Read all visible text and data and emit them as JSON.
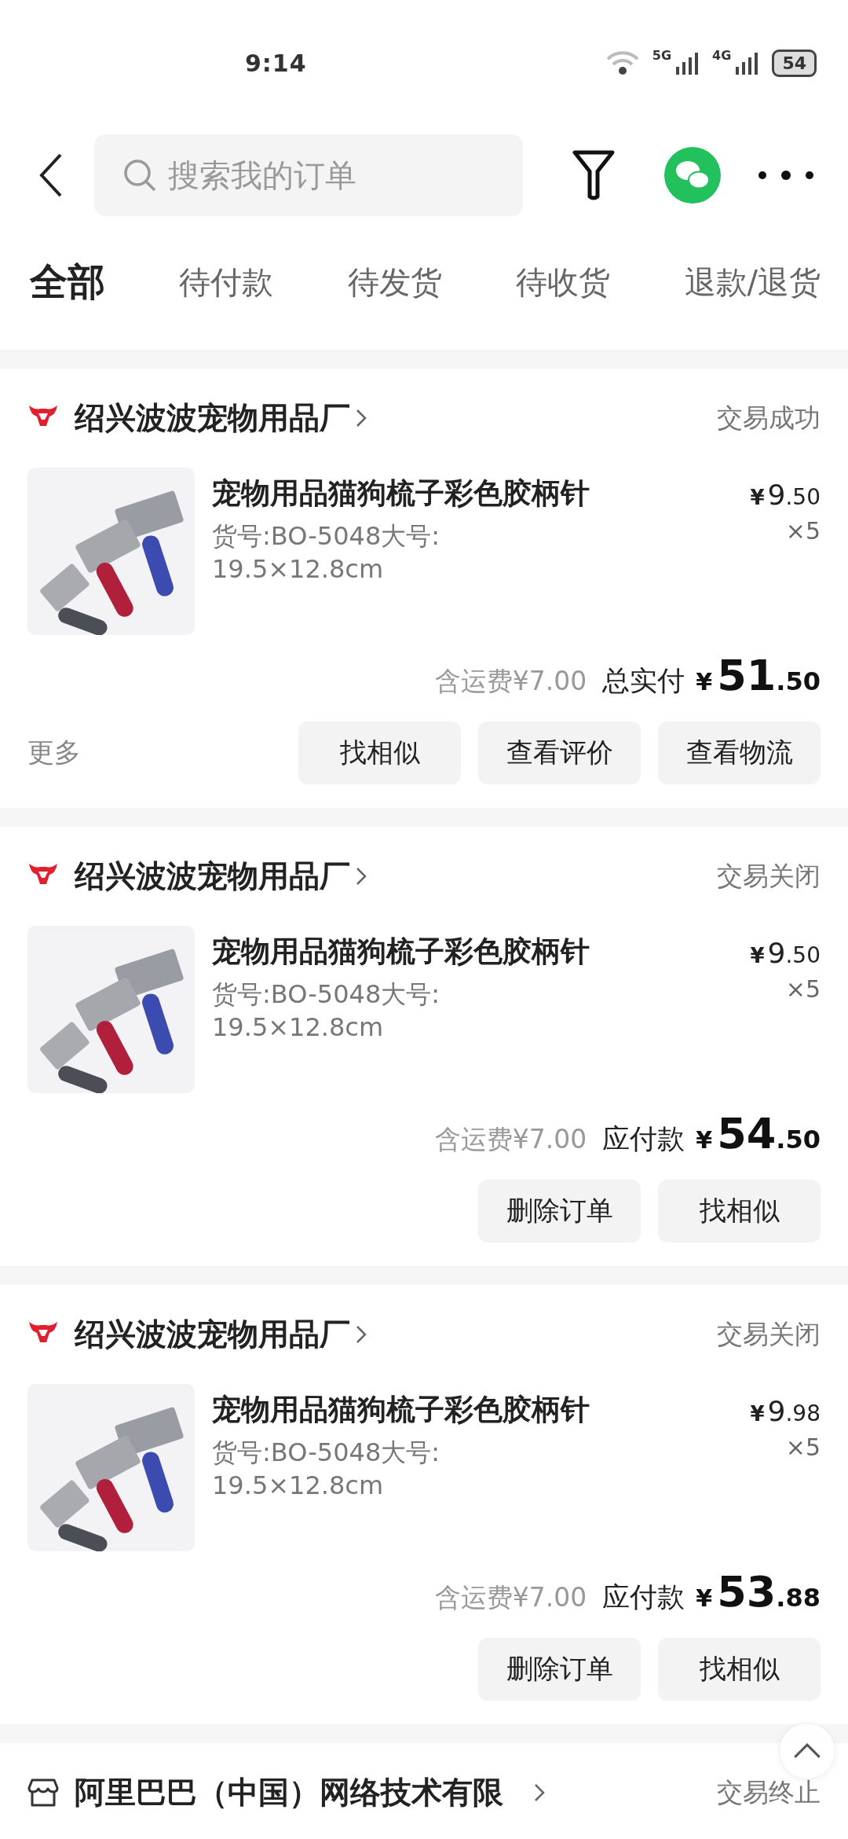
{
  "status_bar": {
    "time": "9:14",
    "network_1": "5G",
    "network_2": "4G",
    "battery": "54"
  },
  "header": {
    "search": {
      "placeholder": "搜索我的订单"
    }
  },
  "tabs": [
    {
      "label": "全部",
      "selected": true
    },
    {
      "label": "待付款",
      "selected": false
    },
    {
      "label": "待发货",
      "selected": false
    },
    {
      "label": "待收货",
      "selected": false
    },
    {
      "label": "退款/退货",
      "selected": false
    }
  ],
  "orders": [
    {
      "store": {
        "kind": "badge",
        "name": "绍兴波波宠物用品厂"
      },
      "status": "交易成功",
      "product": {
        "kind": "picture",
        "title": "宠物用品猫狗梳子彩色胶柄针",
        "spec": "货号:BO-5048大号: 19.5×12.8cm",
        "price": {
          "currency": "¥",
          "integer": "9",
          "decimal": ".50"
        },
        "quantity": "×5"
      },
      "shipping": "含运费¥7.00",
      "total_label": "总实付",
      "total": {
        "currency": "¥",
        "integer": "51",
        "decimal": ".50"
      },
      "more": "更多",
      "buttons": [
        "找相似",
        "查看评价",
        "查看物流"
      ]
    },
    {
      "store": {
        "kind": "badge",
        "name": "绍兴波波宠物用品厂"
      },
      "status": "交易关闭",
      "product": {
        "kind": "picture",
        "title": "宠物用品猫狗梳子彩色胶柄针",
        "spec": "货号:BO-5048大号: 19.5×12.8cm",
        "price": {
          "currency": "¥",
          "integer": "9",
          "decimal": ".50"
        },
        "quantity": "×5"
      },
      "shipping": "含运费¥7.00",
      "total_label": "应付款",
      "total": {
        "currency": "¥",
        "integer": "54",
        "decimal": ".50"
      },
      "buttons": [
        "删除订单",
        "找相似"
      ]
    },
    {
      "store": {
        "kind": "badge",
        "name": "绍兴波波宠物用品厂"
      },
      "status": "交易关闭",
      "product": {
        "kind": "picture",
        "title": "宠物用品猫狗梳子彩色胶柄针",
        "spec": "货号:BO-5048大号: 19.5×12.8cm",
        "price": {
          "currency": "¥",
          "integer": "9",
          "decimal": ".98"
        },
        "quantity": "×5"
      },
      "shipping": "含运费¥7.00",
      "total_label": "应付款",
      "total": {
        "currency": "¥",
        "integer": "53",
        "decimal": ".88"
      },
      "buttons": [
        "删除订单",
        "找相似"
      ]
    },
    {
      "store": {
        "kind": "storefront",
        "name": "阿里巴巴（中国）网络技术有限"
      },
      "status": "交易终止"
    }
  ]
}
